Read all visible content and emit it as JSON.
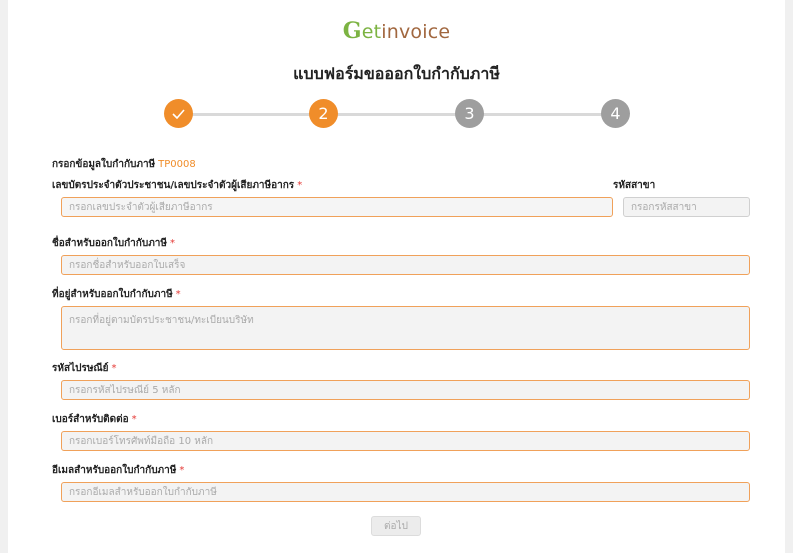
{
  "logo": {
    "g": "G",
    "et": "et",
    "invoice": "invoice"
  },
  "page_title": "แบบฟอร์มขอออกใบกำกับภาษี",
  "steps": [
    {
      "label": "",
      "status": "completed",
      "icon": "check-icon"
    },
    {
      "label": "2",
      "status": "current"
    },
    {
      "label": "3",
      "status": "pending"
    },
    {
      "label": "4",
      "status": "pending"
    }
  ],
  "form": {
    "section_title": "กรอกข้อมูลใบกำกับภาษี",
    "section_code": "TP0008",
    "tax_id": {
      "label": "เลขบัตรประจำตัวประชาชน/เลขประจำตัวผู้เสียภาษีอากร",
      "required_mark": "*",
      "placeholder": "กรอกเลขประจำตัวผู้เสียภาษีอากร"
    },
    "branch_code": {
      "label": "รหัสสาขา",
      "placeholder": "กรอกรหัสสาขา"
    },
    "name": {
      "label": "ชื่อสำหรับออกใบกำกับภาษี",
      "required_mark": "*",
      "placeholder": "กรอกชื่อสำหรับออกใบเสร็จ"
    },
    "address": {
      "label": "ที่อยู่สำหรับออกใบกำกับภาษี",
      "required_mark": "*",
      "placeholder": "กรอกที่อยู่ตามบัตรประชาชน/ทะเบียนบริษัท"
    },
    "postal_code": {
      "label": "รหัสไปรษณีย์",
      "required_mark": "*",
      "placeholder": "กรอกรหัสไปรษณีย์ 5 หลัก"
    },
    "phone": {
      "label": "เบอร์สำหรับติดต่อ",
      "required_mark": "*",
      "placeholder": "กรอกเบอร์โทรศัพท์มือถือ 10 หลัก"
    },
    "email": {
      "label": "อีเมลสำหรับออกใบกำกับภาษี",
      "required_mark": "*",
      "placeholder": "กรอกอีเมลสำหรับออกใบกำกับภาษี"
    },
    "next_button": "ต่อไป"
  },
  "colors": {
    "accent_orange": "#f08d2a",
    "step_pending": "#9e9e9e",
    "logo_green": "#7cb342",
    "logo_brown": "#a1673f",
    "required_red": "#e53935"
  }
}
